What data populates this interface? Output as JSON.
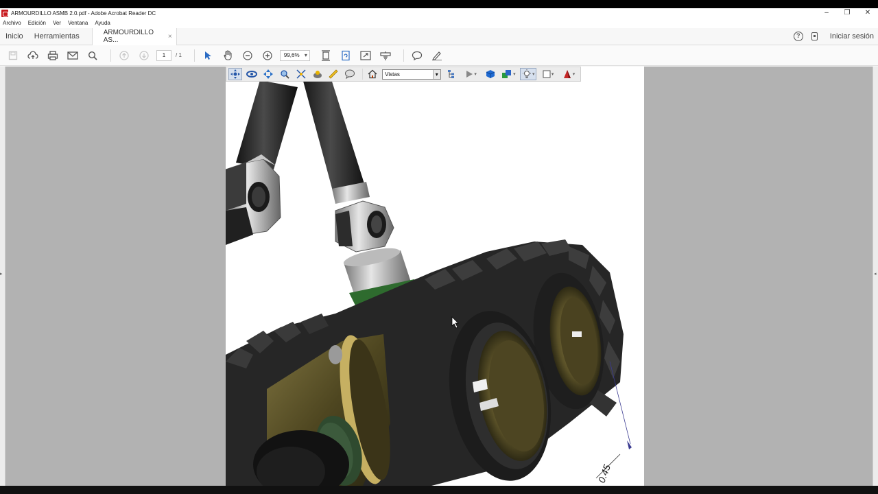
{
  "window": {
    "title": "ARMOURDILLO ASMB 2.0.pdf - Adobe Acrobat Reader DC",
    "controls": {
      "minimize": "–",
      "restore": "❐",
      "close": "✕"
    }
  },
  "menu": {
    "items": [
      "Archivo",
      "Edición",
      "Ver",
      "Ventana",
      "Ayuda"
    ]
  },
  "tabs": {
    "home": "Inicio",
    "tools": "Herramientas",
    "document": "ARMOURDILLO AS...",
    "close": "×",
    "signin": "Iniciar sesión",
    "help": "?"
  },
  "toolbar": {
    "page_current": "1",
    "page_total": "/ 1",
    "zoom": "99,6%"
  },
  "toolbar3d": {
    "views_label": "Vistas"
  },
  "model": {
    "dimension_text": "0.45",
    "colors": {
      "tube": "#2a2a2a",
      "bracket": "#bcbcbc",
      "tread": "#2b2b2b",
      "hub": "#6b6236",
      "gold": "#b9a45a"
    }
  }
}
